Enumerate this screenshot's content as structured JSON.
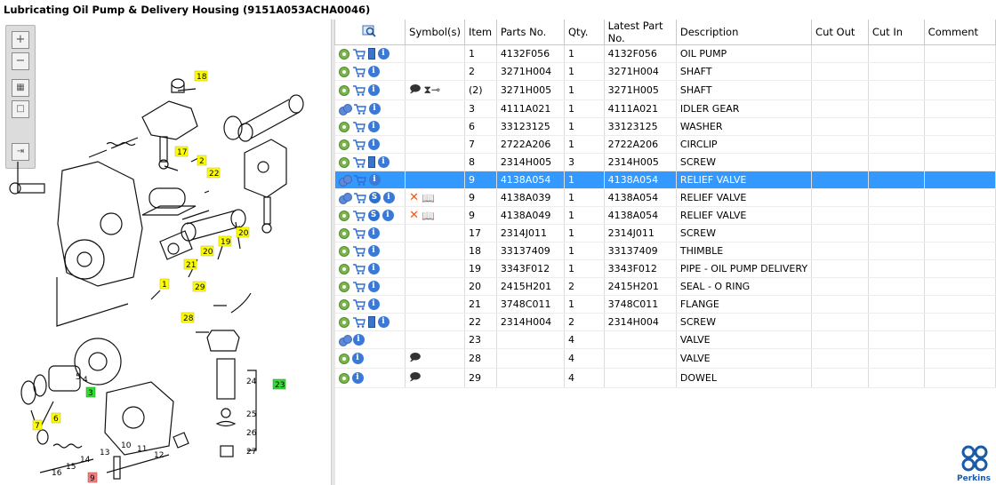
{
  "title": "Lubricating Oil Pump & Delivery Housing (9151A053ACHA0046)",
  "columns": {
    "symbols": "Symbol(s)",
    "item": "Item",
    "parts_no": "Parts No.",
    "qty": "Qty.",
    "latest": "Latest Part No.",
    "description": "Description",
    "cut_out": "Cut Out",
    "cut_in": "Cut In",
    "comment": "Comment"
  },
  "rows": [
    {
      "icons": [
        "gear",
        "cart",
        "book",
        "info"
      ],
      "symbols": "",
      "item": "1",
      "part": "4132F056",
      "qty": "1",
      "latest": "4132F056",
      "desc": "OIL PUMP"
    },
    {
      "icons": [
        "gear",
        "cart",
        "info"
      ],
      "symbols": "",
      "item": "2",
      "part": "3271H004",
      "qty": "1",
      "latest": "3271H004",
      "desc": "SHAFT"
    },
    {
      "icons": [
        "gear",
        "cart",
        "info"
      ],
      "symbols": "note+clamp",
      "item": "(2)",
      "part": "3271H005",
      "qty": "1",
      "latest": "3271H005",
      "desc": "SHAFT"
    },
    {
      "icons": [
        "gear2",
        "cart",
        "info"
      ],
      "symbols": "",
      "item": "3",
      "part": "4111A021",
      "qty": "1",
      "latest": "4111A021",
      "desc": "IDLER GEAR"
    },
    {
      "icons": [
        "gear",
        "cart",
        "info"
      ],
      "symbols": "",
      "item": "6",
      "part": "33123125",
      "qty": "1",
      "latest": "33123125",
      "desc": "WASHER"
    },
    {
      "icons": [
        "gear",
        "cart",
        "info"
      ],
      "symbols": "",
      "item": "7",
      "part": "2722A206",
      "qty": "1",
      "latest": "2722A206",
      "desc": "CIRCLIP"
    },
    {
      "icons": [
        "gear",
        "cart",
        "book",
        "info"
      ],
      "symbols": "",
      "item": "8",
      "part": "2314H005",
      "qty": "3",
      "latest": "2314H005",
      "desc": "SCREW"
    },
    {
      "icons": [
        "gear2",
        "cart",
        "info"
      ],
      "symbols": "",
      "item": "9",
      "part": "4138A054",
      "qty": "1",
      "latest": "4138A054",
      "desc": "RELIEF VALVE",
      "selected": true
    },
    {
      "icons": [
        "gear2",
        "cart",
        "s",
        "info"
      ],
      "symbols": "x+book",
      "item": "9",
      "part": "4138A039",
      "qty": "1",
      "latest": "4138A054",
      "desc": "RELIEF VALVE"
    },
    {
      "icons": [
        "gear",
        "cart",
        "s",
        "info"
      ],
      "symbols": "x+book",
      "item": "9",
      "part": "4138A049",
      "qty": "1",
      "latest": "4138A054",
      "desc": "RELIEF VALVE"
    },
    {
      "icons": [
        "gear",
        "cart",
        "info"
      ],
      "symbols": "",
      "item": "17",
      "part": "2314J011",
      "qty": "1",
      "latest": "2314J011",
      "desc": "SCREW"
    },
    {
      "icons": [
        "gear",
        "cart",
        "info"
      ],
      "symbols": "",
      "item": "18",
      "part": "33137409",
      "qty": "1",
      "latest": "33137409",
      "desc": "THIMBLE"
    },
    {
      "icons": [
        "gear",
        "cart",
        "info"
      ],
      "symbols": "",
      "item": "19",
      "part": "3343F012",
      "qty": "1",
      "latest": "3343F012",
      "desc": "PIPE - OIL PUMP DELIVERY"
    },
    {
      "icons": [
        "gear",
        "cart",
        "info"
      ],
      "symbols": "",
      "item": "20",
      "part": "2415H201",
      "qty": "2",
      "latest": "2415H201",
      "desc": "SEAL - O RING"
    },
    {
      "icons": [
        "gear",
        "cart",
        "info"
      ],
      "symbols": "",
      "item": "21",
      "part": "3748C011",
      "qty": "1",
      "latest": "3748C011",
      "desc": "FLANGE"
    },
    {
      "icons": [
        "gear",
        "cart",
        "book",
        "info"
      ],
      "symbols": "",
      "item": "22",
      "part": "2314H004",
      "qty": "2",
      "latest": "2314H004",
      "desc": "SCREW"
    },
    {
      "icons": [
        "gear2",
        "info"
      ],
      "symbols": "",
      "item": "23",
      "part": "",
      "qty": "4",
      "latest": "",
      "desc": "VALVE"
    },
    {
      "icons": [
        "gear",
        "info"
      ],
      "symbols": "note",
      "item": "28",
      "part": "",
      "qty": "4",
      "latest": "",
      "desc": "VALVE"
    },
    {
      "icons": [
        "gear",
        "info"
      ],
      "symbols": "note",
      "item": "29",
      "part": "",
      "qty": "4",
      "latest": "",
      "desc": "DOWEL"
    }
  ],
  "diagram_labels": [
    "18",
    "17",
    "2",
    "22",
    "19",
    "20",
    "20",
    "21",
    "1",
    "29",
    "28",
    "3",
    "4",
    "5",
    "6",
    "7",
    "10",
    "11",
    "12",
    "13",
    "14",
    "15",
    "16",
    "9",
    "23",
    "24",
    "25",
    "26",
    "27"
  ],
  "brand": "Perkins"
}
